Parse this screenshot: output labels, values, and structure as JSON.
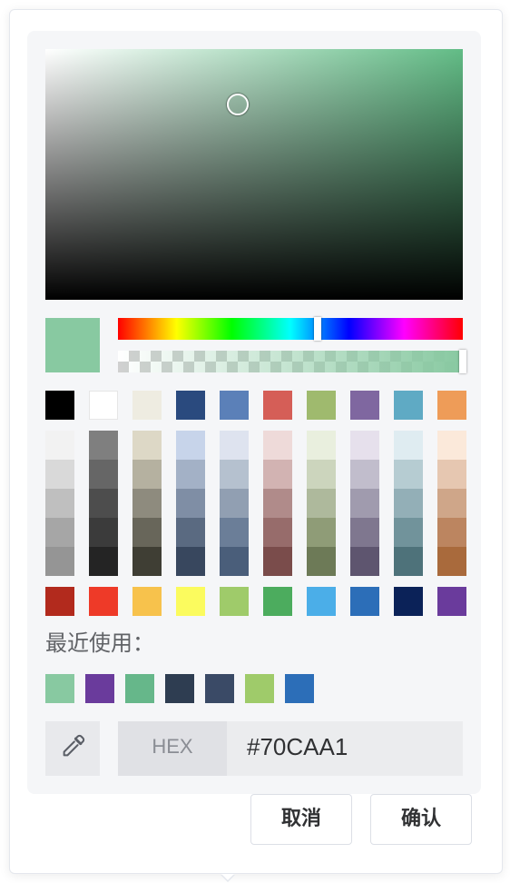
{
  "picker": {
    "current_color": "#88C9A1",
    "hue_color": "#62BC86",
    "hue_fraction": 0.58,
    "sv_saturation": 0.46,
    "sv_value": 0.78,
    "alpha": 1.0
  },
  "palette": {
    "top_colors": [
      "#000000",
      "#FFFFFF",
      "#EEECE1",
      "#2A4A7E",
      "#5B80B8",
      "#D55E57",
      "#9FBA6E",
      "#7F67A0",
      "#5FAAC4",
      "#EE9C58"
    ],
    "shade_columns": [
      [
        "#F2F2F2",
        "#D9D9D9",
        "#BFBFBF",
        "#A6A6A6",
        "#959595"
      ],
      [
        "#7F7F7F",
        "#666666",
        "#4D4D4D",
        "#3B3B3B",
        "#242424"
      ],
      [
        "#DDD8C6",
        "#B5B1A0",
        "#8E8B7E",
        "#68665A",
        "#3F3E34"
      ],
      [
        "#C7D4EA",
        "#A3B1C6",
        "#7F8EA5",
        "#5A6A81",
        "#38475E"
      ],
      [
        "#DEE3EF",
        "#B5C1CF",
        "#919FB2",
        "#6B7E98",
        "#4A5E7A"
      ],
      [
        "#EEDAD9",
        "#D2B3B2",
        "#B08B8A",
        "#976C6B",
        "#7A4C4B"
      ],
      [
        "#E9EFDE",
        "#CCD5BD",
        "#AEB99C",
        "#8F9C77",
        "#6D7A57"
      ],
      [
        "#E6E0EC",
        "#C1BDCC",
        "#A09BAE",
        "#7F778F",
        "#5E556F"
      ],
      [
        "#DFECF1",
        "#B6CCD2",
        "#93AFB7",
        "#71939B",
        "#4E727A"
      ],
      [
        "#FBE9DA",
        "#E6C7B1",
        "#CFA689",
        "#BC8560",
        "#A96A3C"
      ]
    ],
    "bottom_colors": [
      "#B22A1D",
      "#EE3A28",
      "#F7C24C",
      "#FBFB5E",
      "#9FCB6A",
      "#4CAC5E",
      "#4BAEE8",
      "#2C6EB8",
      "#0B2258",
      "#6A3B9C"
    ]
  },
  "recent": {
    "label": "最近使用：",
    "colors": [
      "#88C9A1",
      "#6A3B9C",
      "#66B78A",
      "#2E3D51",
      "#3A4A66",
      "#9FCB6A",
      "#2C6EB8"
    ]
  },
  "hex": {
    "tag_label": "HEX",
    "value": "#70CAA1"
  },
  "buttons": {
    "cancel_label": "取消",
    "confirm_label": "确认"
  },
  "icons": {
    "eyedropper": "eyedropper-icon"
  }
}
